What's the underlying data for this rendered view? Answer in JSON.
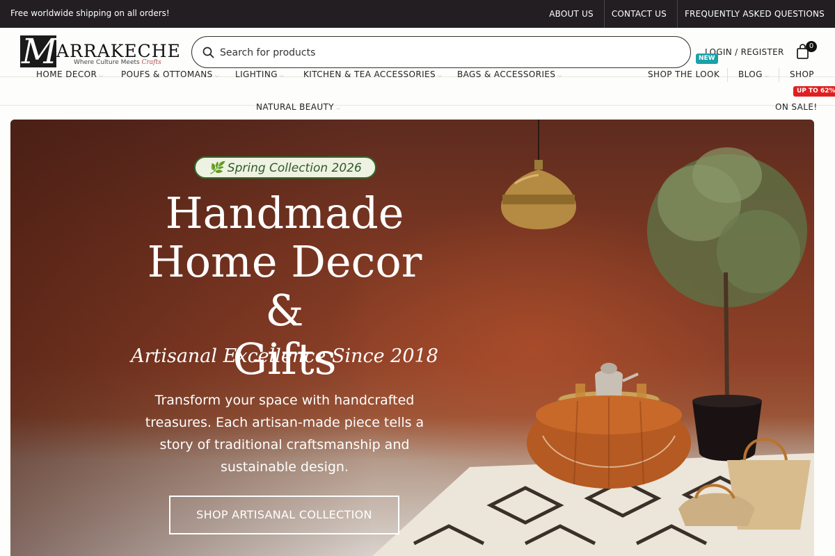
{
  "topbar": {
    "promo": "Free worldwide shipping on all orders!",
    "links": [
      "ABOUT US",
      "CONTACT US",
      "FREQUENTLY ASKED QUESTIONS"
    ]
  },
  "header": {
    "logo_word": "ARRAKECHE",
    "logo_letter": "M",
    "logo_tagline": "Where Culture Meets",
    "logo_tagline_script": "Crafts",
    "search_placeholder": "Search for products",
    "login": "LOGIN / REGISTER",
    "cart_count": "0"
  },
  "nav": {
    "items": [
      {
        "label": "HOME DECOR"
      },
      {
        "label": "POUFS & OTTOMANS"
      },
      {
        "label": "LIGHTING"
      },
      {
        "label": "KITCHEN & TEA ACCESSORIES"
      },
      {
        "label": "BAGS & ACCESSORIES"
      },
      {
        "label": "NATURAL BEAUTY"
      }
    ],
    "right": [
      {
        "label": "SHOP THE LOOK",
        "badge": "NEW"
      },
      {
        "label": "BLOG"
      },
      {
        "label": "SHOP"
      },
      {
        "label": "ON SALE!",
        "badge": "UP TO 62%"
      }
    ]
  },
  "hero": {
    "pill": "🌿 Spring Collection 2026",
    "title_line1": "Handmade",
    "title_line2": "Home Decor &",
    "title_line3": "Gifts",
    "script": "Artisanal Excellence Since 2018",
    "description": "Transform your space with handcrafted treasures. Each artisan-made piece tells a story of traditional craftsmanship and sustainable design.",
    "cta": "SHOP ARTISANAL COLLECTION"
  },
  "colors": {
    "topbar_bg": "#221e21",
    "new_badge": "#1aa0a8",
    "sale_badge": "#e02020",
    "pill_border": "#2f6b2a"
  }
}
